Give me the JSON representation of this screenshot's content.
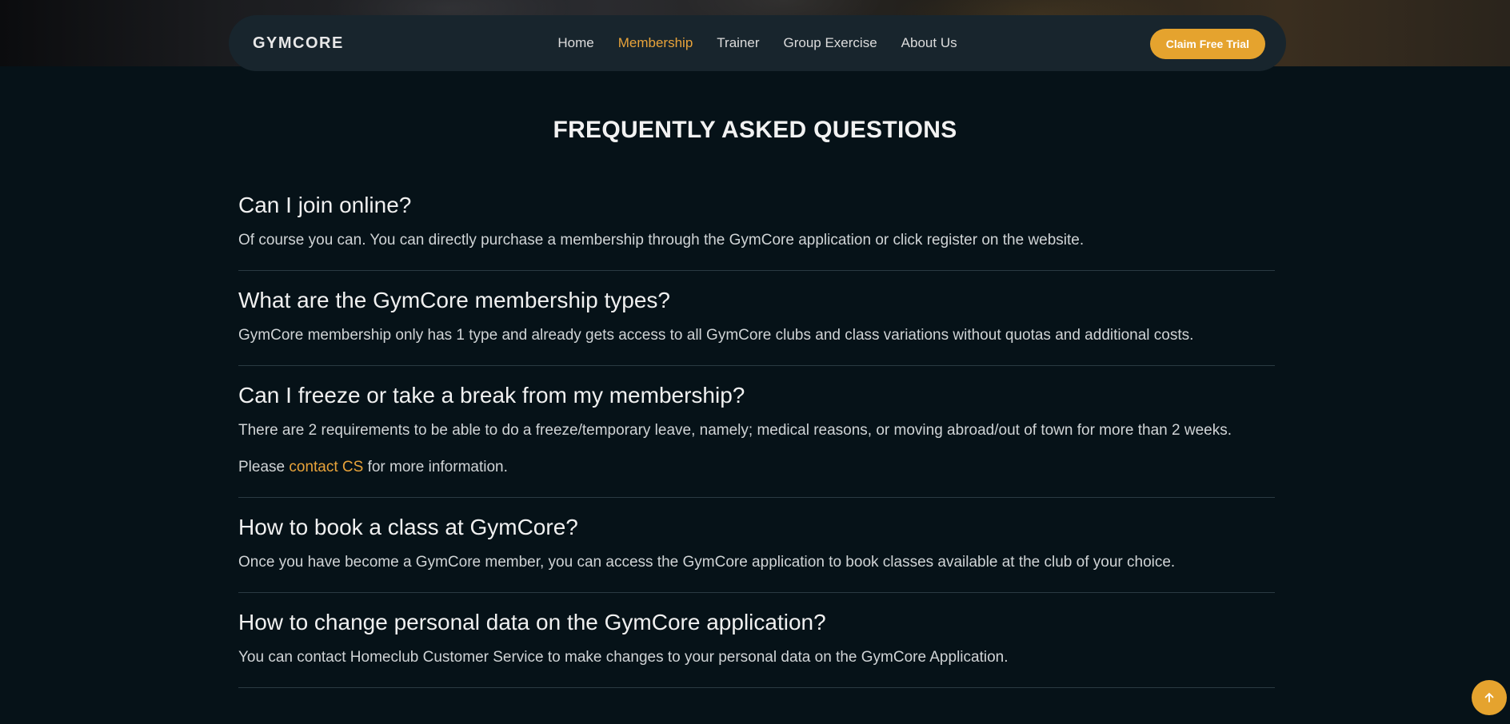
{
  "brand": "GYMCORE",
  "nav": {
    "items": [
      {
        "label": "Home",
        "active": false
      },
      {
        "label": "Membership",
        "active": true
      },
      {
        "label": "Trainer",
        "active": false
      },
      {
        "label": "Group Exercise",
        "active": false
      },
      {
        "label": "About Us",
        "active": false
      }
    ],
    "cta_label": "Claim Free Trial"
  },
  "colors": {
    "accent": "#e5a32e",
    "background": "#061218",
    "navbar": "#18252d"
  },
  "faq": {
    "title": "FREQUENTLY ASKED QUESTIONS",
    "items": [
      {
        "question": "Can I join online?",
        "answer": "Of course you can. You can directly purchase a membership through the GymCore application or click register on the website."
      },
      {
        "question": "What are the GymCore membership types?",
        "answer": "GymCore membership only has 1 type and already gets access to all GymCore clubs and class variations without quotas and additional costs."
      },
      {
        "question": "Can I freeze or take a break from my membership?",
        "answer": "There are 2 requirements to be able to do a freeze/temporary leave, namely; medical reasons, or moving abroad/out of town for more than 2 weeks.",
        "note_prefix": "Please ",
        "note_link": "contact CS",
        "note_suffix": " for more information."
      },
      {
        "question": "How to book a class at GymCore?",
        "answer": "Once you have become a GymCore member, you can access the GymCore application to book classes available at the club of your choice."
      },
      {
        "question": "How to change personal data on the GymCore application?",
        "answer": "You can contact Homeclub Customer Service to make changes to your personal data on the GymCore Application."
      }
    ]
  },
  "back_to_top_icon": "arrow-up-icon"
}
